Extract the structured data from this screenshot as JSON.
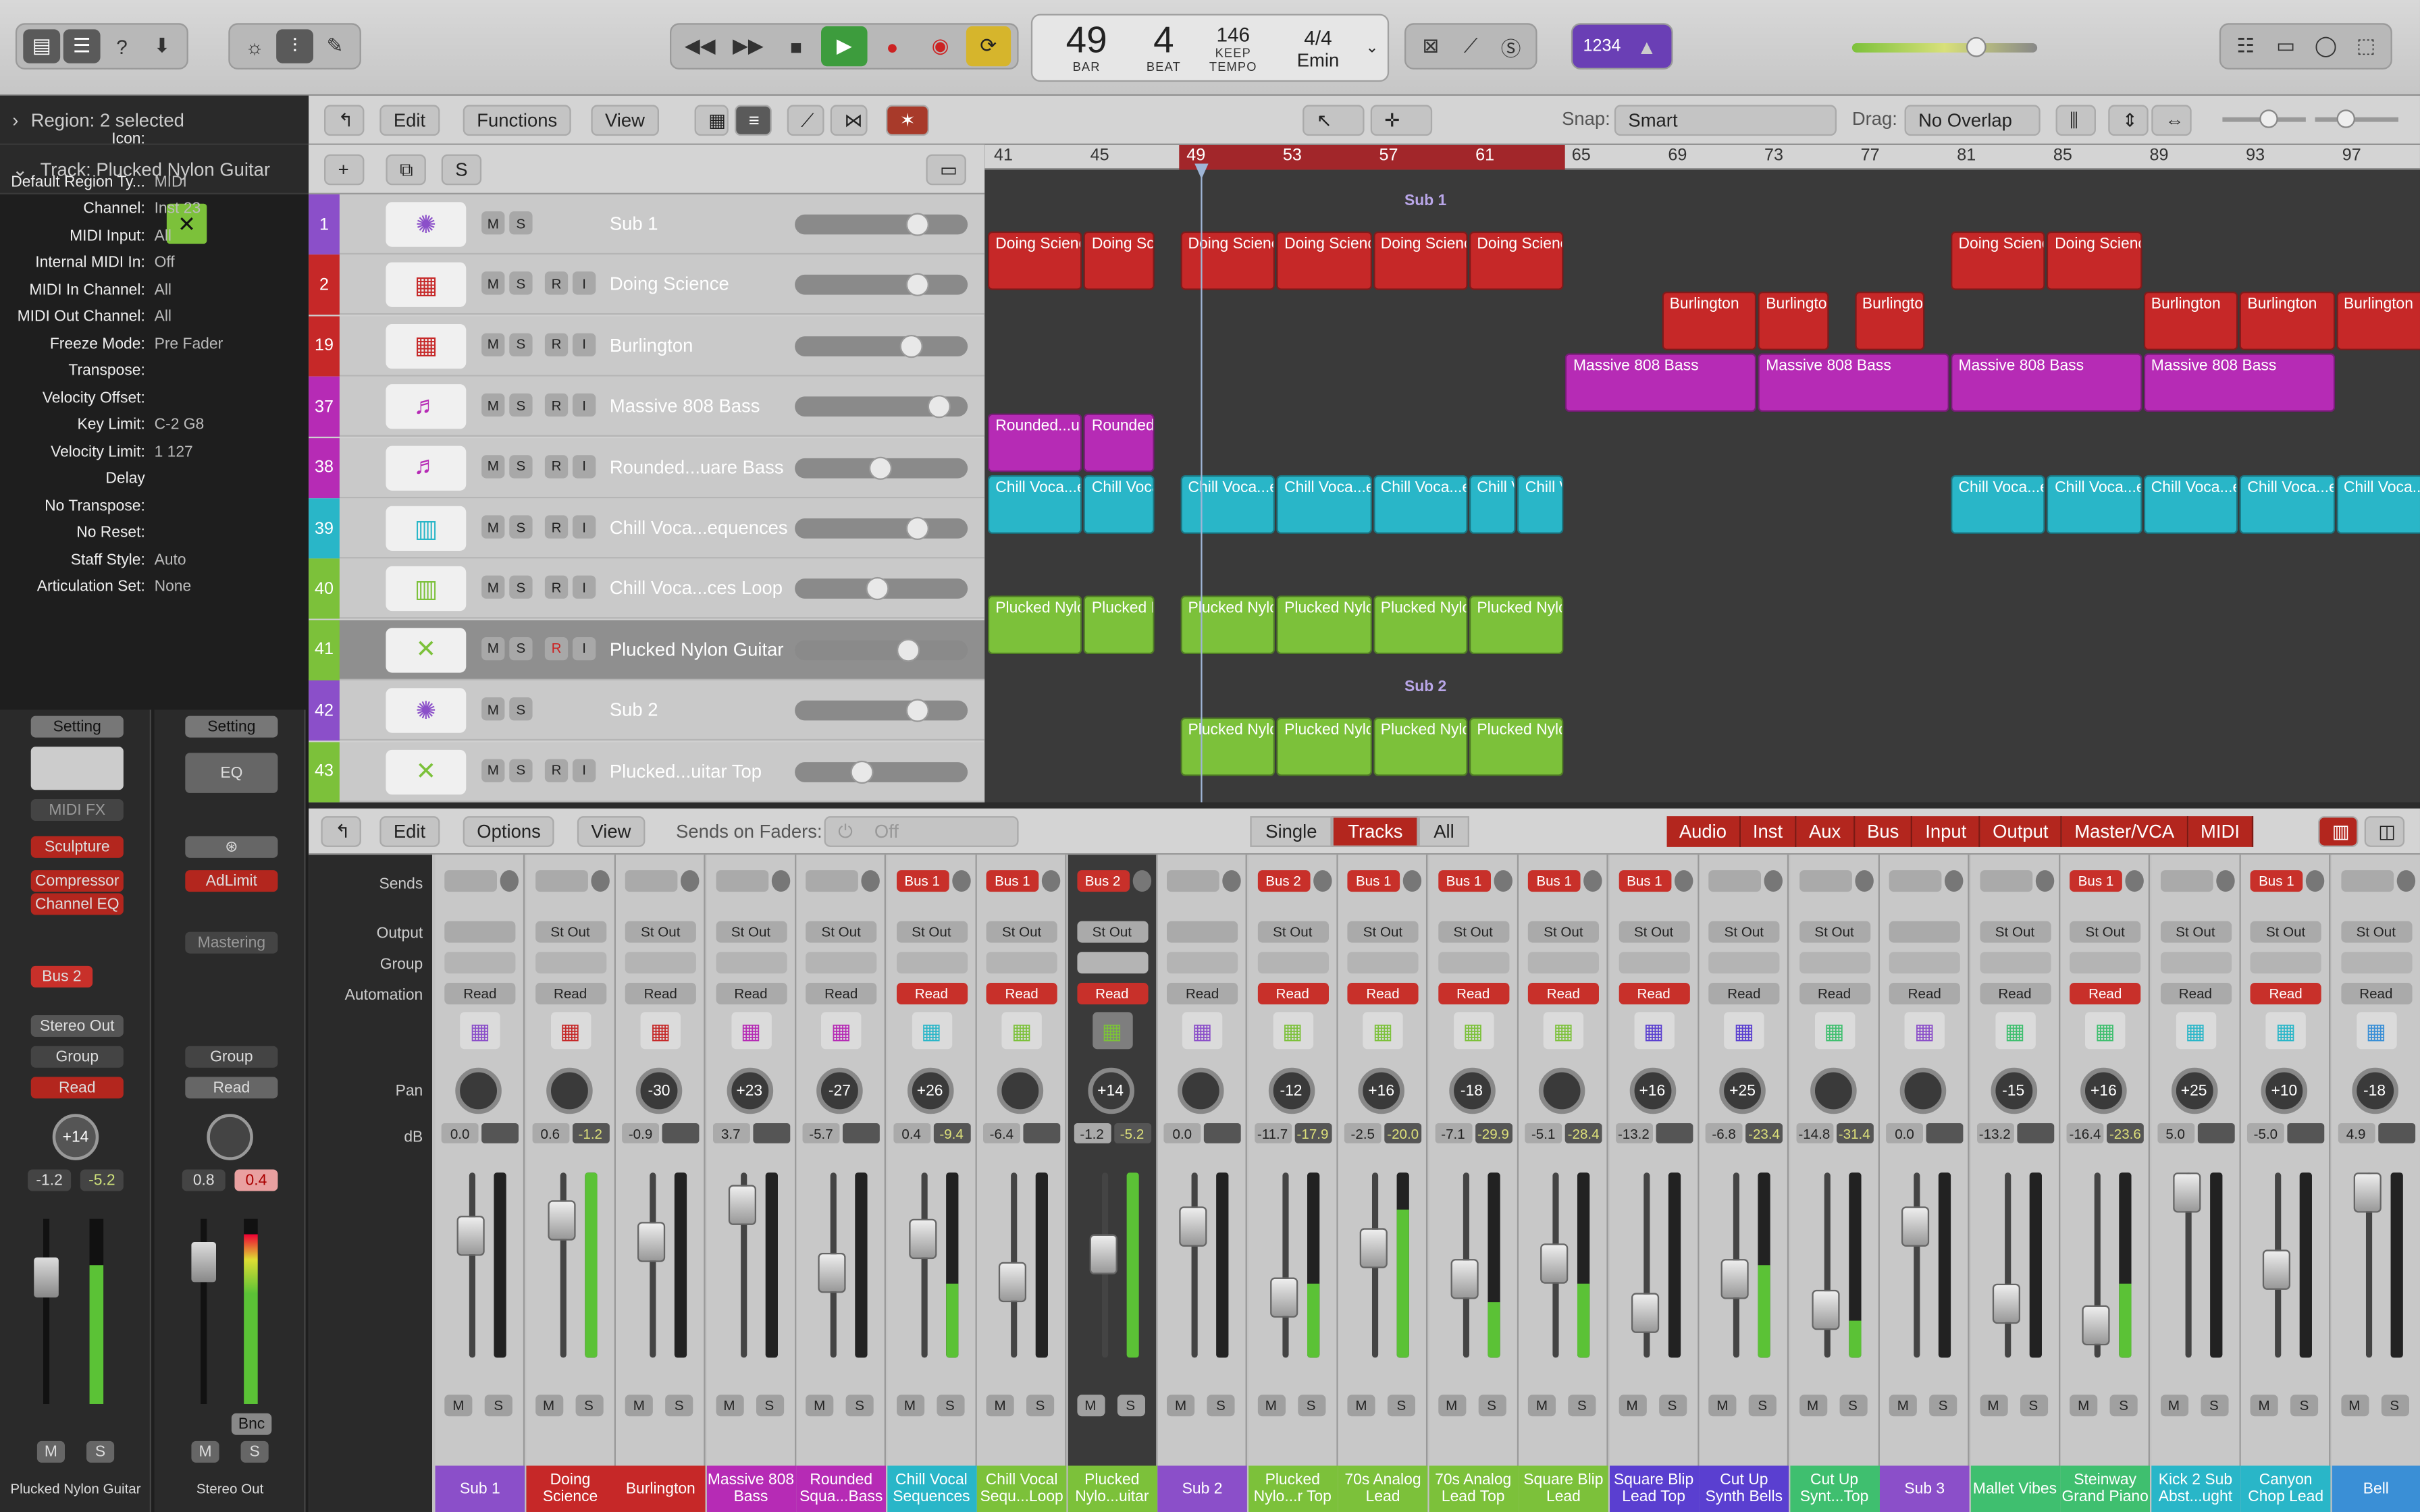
{
  "toolbar": {
    "lcd": {
      "bar": "49",
      "beat": "4",
      "bar_label": "BAR",
      "beat_label": "BEAT",
      "tempo": "146",
      "tempo_mode": "KEEP",
      "tempo_label": "TEMPO",
      "signature": "4/4",
      "key": "Emin"
    },
    "count_in": "1234"
  },
  "inspector": {
    "region_label": "Region: 2 selected",
    "track_label": "Track: Plucked Nylon Guitar",
    "rows": [
      {
        "label": "Icon:",
        "value": ""
      },
      {
        "label": "Default Region Ty...",
        "value": "MIDI"
      },
      {
        "label": "Channel:",
        "value": "Inst 23"
      },
      {
        "label": "MIDI Input:",
        "value": "All"
      },
      {
        "label": "Internal MIDI In:",
        "value": "Off"
      },
      {
        "label": "MIDI In Channel:",
        "value": "All"
      },
      {
        "label": "MIDI Out Channel:",
        "value": "All"
      },
      {
        "label": "Freeze Mode:",
        "value": "Pre Fader"
      },
      {
        "label": "Transpose:",
        "value": ""
      },
      {
        "label": "Velocity Offset:",
        "value": ""
      },
      {
        "label": "Key Limit:",
        "value": "C-2  G8"
      },
      {
        "label": "Velocity Limit:",
        "value": "1  127"
      },
      {
        "label": "Delay",
        "value": ""
      },
      {
        "label": "No Transpose:",
        "value": ""
      },
      {
        "label": "No Reset:",
        "value": ""
      },
      {
        "label": "Staff Style:",
        "value": "Auto"
      },
      {
        "label": "Articulation Set:",
        "value": "None"
      }
    ],
    "strip1": {
      "setting": "Setting",
      "midi_fx": "MIDI FX",
      "plugins": [
        "Sculpture",
        "Compressor",
        "Channel EQ"
      ],
      "send": "Bus 2",
      "output": "Stereo Out",
      "group": "Group",
      "automation": "Read",
      "pan": "+14",
      "db1": "-1.2",
      "db2": "-5.2",
      "m": "M",
      "s": "S",
      "name": "Plucked Nylon Guitar"
    },
    "strip2": {
      "setting": "Setting",
      "eq": "EQ",
      "plugins": [
        "AdLimit"
      ],
      "mastering": "Mastering",
      "group": "Group",
      "automation": "Read",
      "db1": "0.8",
      "db2": "0.4",
      "bnc": "Bnc",
      "m": "M",
      "s": "S",
      "name": "Stereo Out"
    }
  },
  "arrange": {
    "menus": [
      "Edit",
      "Functions",
      "View"
    ],
    "snap_label": "Snap:",
    "snap_value": "Smart",
    "drag_label": "Drag:",
    "drag_value": "No Overlap",
    "ruler": [
      "41",
      "45",
      "49",
      "53",
      "57",
      "61",
      "65",
      "69",
      "73",
      "77",
      "81",
      "85",
      "89",
      "93",
      "97"
    ],
    "tracks": [
      {
        "num": "1",
        "name": "Sub 1",
        "color": "#8b4fc9",
        "rec": false
      },
      {
        "num": "2",
        "name": "Doing Science",
        "color": "#c62828",
        "rec": true
      },
      {
        "num": "19",
        "name": "Burlington",
        "color": "#c62828",
        "rec": true
      },
      {
        "num": "37",
        "name": "Massive 808 Bass",
        "color": "#b62bb5",
        "rec": true
      },
      {
        "num": "38",
        "name": "Rounded...uare Bass",
        "color": "#b62bb5",
        "rec": true
      },
      {
        "num": "39",
        "name": "Chill Voca...equences",
        "color": "#29b6c8",
        "rec": true
      },
      {
        "num": "40",
        "name": "Chill Voca...ces Loop",
        "color": "#7cc13a",
        "rec": true
      },
      {
        "num": "41",
        "name": "Plucked Nylon Guitar",
        "color": "#7cc13a",
        "rec": true
      },
      {
        "num": "42",
        "name": "Sub 2",
        "color": "#8b4fc9",
        "rec": false
      },
      {
        "num": "43",
        "name": "Plucked...uitar Top",
        "color": "#7cc13a",
        "rec": true
      }
    ],
    "folder_labels": [
      "Sub 1",
      "Sub 2"
    ]
  },
  "mixer": {
    "menus": [
      "Edit",
      "Options",
      "View"
    ],
    "sends_on_faders": "Sends on Faders:",
    "off": "Off",
    "views": [
      "Single",
      "Tracks",
      "All"
    ],
    "filters": [
      "Audio",
      "Inst",
      "Aux",
      "Bus",
      "Input",
      "Output",
      "Master/VCA",
      "MIDI"
    ],
    "row_labels": [
      "Sends",
      "Output",
      "Group",
      "Automation",
      "Pan",
      "dB"
    ],
    "strips": [
      {
        "name": "Sub 1",
        "color": "#8b4fc9",
        "send": "",
        "output": "",
        "pan": "",
        "db": "0.0",
        "peak": ""
      },
      {
        "name": "Doing Science",
        "color": "#c62828",
        "send": "",
        "output": "St Out",
        "pan": "",
        "db": "0.6",
        "peak": "-1.2"
      },
      {
        "name": "Burlington",
        "color": "#c62828",
        "send": "",
        "output": "St Out",
        "pan": "-30",
        "db": "-0.9",
        "peak": ""
      },
      {
        "name": "Massive 808 Bass",
        "color": "#b62bb5",
        "send": "",
        "output": "St Out",
        "pan": "+23",
        "db": "3.7",
        "peak": ""
      },
      {
        "name": "Rounded Squa...Bass",
        "color": "#b62bb5",
        "send": "",
        "output": "St Out",
        "pan": "-27",
        "db": "-5.7",
        "peak": ""
      },
      {
        "name": "Chill Vocal Sequences",
        "color": "#29b6c8",
        "send": "Bus 1",
        "output": "St Out",
        "pan": "+26",
        "db": "0.4",
        "peak": "-9.4"
      },
      {
        "name": "Chill Vocal Sequ...Loop",
        "color": "#7cc13a",
        "send": "Bus 1",
        "output": "St Out",
        "pan": "",
        "db": "-6.4",
        "peak": ""
      },
      {
        "name": "Plucked Nylo...uitar",
        "color": "#7cc13a",
        "send": "Bus 2",
        "output": "St Out",
        "pan": "+14",
        "db": "-1.2",
        "peak": "-5.2"
      },
      {
        "name": "Sub 2",
        "color": "#8b4fc9",
        "send": "",
        "output": "",
        "pan": "",
        "db": "0.0",
        "peak": ""
      },
      {
        "name": "Plucked Nylo...r Top",
        "color": "#7cc13a",
        "send": "Bus 2",
        "output": "St Out",
        "pan": "-12",
        "db": "-11.7",
        "peak": "-17.9"
      },
      {
        "name": "70s Analog Lead",
        "color": "#7cc13a",
        "send": "Bus 1",
        "output": "St Out",
        "pan": "+16",
        "db": "-2.5",
        "peak": "-20.0"
      },
      {
        "name": "70s Analog Lead Top",
        "color": "#7cc13a",
        "send": "Bus 1",
        "output": "St Out",
        "pan": "-18",
        "db": "-7.1",
        "peak": "-29.9"
      },
      {
        "name": "Square Blip Lead",
        "color": "#7cc13a",
        "send": "Bus 1",
        "output": "St Out",
        "pan": "",
        "db": "-5.1",
        "peak": "-28.4"
      },
      {
        "name": "Square Blip Lead Top",
        "color": "#5a3fd0",
        "send": "Bus 1",
        "output": "St Out",
        "pan": "+16",
        "db": "-13.2",
        "peak": ""
      },
      {
        "name": "Cut Up Synth Bells",
        "color": "#5a3fd0",
        "send": "",
        "output": "St Out",
        "pan": "+25",
        "db": "-6.8",
        "peak": "-23.4"
      },
      {
        "name": "Cut Up Synt...Top",
        "color": "#3fbf6f",
        "send": "",
        "output": "St Out",
        "pan": "",
        "db": "-14.8",
        "peak": "-31.4"
      },
      {
        "name": "Sub 3",
        "color": "#8b4fc9",
        "send": "",
        "output": "",
        "pan": "",
        "db": "0.0",
        "peak": ""
      },
      {
        "name": "Mallet Vibes",
        "color": "#3fbf6f",
        "send": "",
        "output": "St Out",
        "pan": "-15",
        "db": "-13.2",
        "peak": ""
      },
      {
        "name": "Steinway Grand Piano",
        "color": "#3fbf6f",
        "send": "Bus 1",
        "output": "St Out",
        "pan": "+16",
        "db": "-16.4",
        "peak": "-23.6"
      },
      {
        "name": "Kick 2 Sub Abst...ught",
        "color": "#29b6c8",
        "send": "",
        "output": "St Out",
        "pan": "+25",
        "db": "5.0",
        "peak": ""
      },
      {
        "name": "Canyon Chop Lead",
        "color": "#29b6c8",
        "send": "Bus 1",
        "output": "St Out",
        "pan": "+10",
        "db": "-5.0",
        "peak": ""
      },
      {
        "name": "Bell",
        "color": "#3a8fd6",
        "send": "",
        "output": "St Out",
        "pan": "-18",
        "db": "4.9",
        "peak": ""
      }
    ],
    "automation": "Read",
    "m": "M",
    "s": "S"
  }
}
